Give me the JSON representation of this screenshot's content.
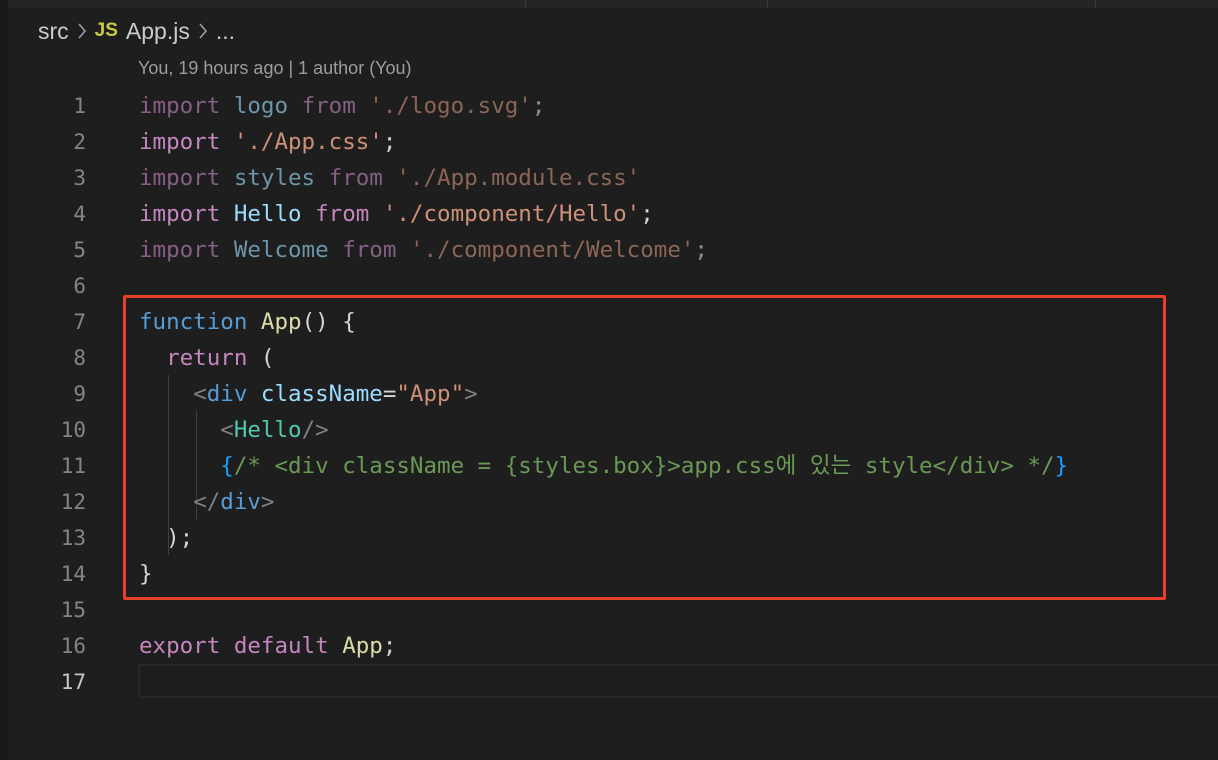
{
  "breadcrumb": {
    "folder": "src",
    "file_icon": "JS",
    "file": "App.js",
    "more": "...",
    "separator_icon": "chevron-right-icon"
  },
  "codelens": "You, 19 hours ago | 1 author (You)",
  "lines": [
    {
      "n": "1",
      "dim": true,
      "tokens": [
        {
          "t": "import",
          "c": "kw"
        },
        {
          "t": " "
        },
        {
          "t": "logo",
          "c": "id"
        },
        {
          "t": " "
        },
        {
          "t": "from",
          "c": "kw"
        },
        {
          "t": " "
        },
        {
          "t": "'./logo.svg'",
          "c": "str"
        },
        {
          "t": ";",
          "c": "pun"
        }
      ]
    },
    {
      "n": "2",
      "tokens": [
        {
          "t": "import",
          "c": "kw"
        },
        {
          "t": " "
        },
        {
          "t": "'./App.css'",
          "c": "str"
        },
        {
          "t": ";",
          "c": "pun"
        }
      ]
    },
    {
      "n": "3",
      "dim": true,
      "tokens": [
        {
          "t": "import",
          "c": "kw"
        },
        {
          "t": " "
        },
        {
          "t": "styles",
          "c": "id"
        },
        {
          "t": " "
        },
        {
          "t": "from",
          "c": "kw"
        },
        {
          "t": " "
        },
        {
          "t": "'./App.module.css'",
          "c": "str"
        }
      ]
    },
    {
      "n": "4",
      "tokens": [
        {
          "t": "import",
          "c": "kw"
        },
        {
          "t": " "
        },
        {
          "t": "Hello",
          "c": "id"
        },
        {
          "t": " "
        },
        {
          "t": "from",
          "c": "kw"
        },
        {
          "t": " "
        },
        {
          "t": "'./component/Hello'",
          "c": "str"
        },
        {
          "t": ";",
          "c": "pun"
        }
      ]
    },
    {
      "n": "5",
      "dim": true,
      "tokens": [
        {
          "t": "import",
          "c": "kw"
        },
        {
          "t": " "
        },
        {
          "t": "Welcome",
          "c": "id"
        },
        {
          "t": " "
        },
        {
          "t": "from",
          "c": "kw"
        },
        {
          "t": " "
        },
        {
          "t": "'./component/Welcome'",
          "c": "str"
        },
        {
          "t": ";",
          "c": "pun"
        }
      ]
    },
    {
      "n": "6",
      "tokens": []
    },
    {
      "n": "7",
      "tokens": [
        {
          "t": "function",
          "c": "st"
        },
        {
          "t": " "
        },
        {
          "t": "App",
          "c": "fn"
        },
        {
          "t": "() {",
          "c": "pun"
        }
      ]
    },
    {
      "n": "8",
      "tokens": [
        {
          "t": "  "
        },
        {
          "t": "return",
          "c": "kw"
        },
        {
          "t": " (",
          "c": "pun"
        }
      ]
    },
    {
      "n": "9",
      "tokens": [
        {
          "t": "    "
        },
        {
          "t": "<",
          "c": "br"
        },
        {
          "t": "div",
          "c": "tag"
        },
        {
          "t": " "
        },
        {
          "t": "className",
          "c": "attr"
        },
        {
          "t": "=",
          "c": "pun"
        },
        {
          "t": "\"App\"",
          "c": "str"
        },
        {
          "t": ">",
          "c": "br"
        }
      ]
    },
    {
      "n": "10",
      "tokens": [
        {
          "t": "      "
        },
        {
          "t": "<",
          "c": "br"
        },
        {
          "t": "Hello",
          "c": "comp"
        },
        {
          "t": "/>",
          "c": "br"
        }
      ]
    },
    {
      "n": "11",
      "tokens": [
        {
          "t": "      "
        },
        {
          "t": "{",
          "c": "jsxb"
        },
        {
          "t": "/* <div className = {styles.box}>app.css에 있는 style</div> */",
          "c": "cmt"
        },
        {
          "t": "}",
          "c": "jsxb"
        }
      ]
    },
    {
      "n": "12",
      "tokens": [
        {
          "t": "    "
        },
        {
          "t": "</",
          "c": "br"
        },
        {
          "t": "div",
          "c": "tag"
        },
        {
          "t": ">",
          "c": "br"
        }
      ]
    },
    {
      "n": "13",
      "tokens": [
        {
          "t": "  "
        },
        {
          "t": ");",
          "c": "pun"
        }
      ]
    },
    {
      "n": "14",
      "tokens": [
        {
          "t": "}",
          "c": "pun"
        }
      ]
    },
    {
      "n": "15",
      "tokens": []
    },
    {
      "n": "16",
      "tokens": [
        {
          "t": "export",
          "c": "kw"
        },
        {
          "t": " "
        },
        {
          "t": "default",
          "c": "kw"
        },
        {
          "t": " "
        },
        {
          "t": "App",
          "c": "fn"
        },
        {
          "t": ";",
          "c": "pun"
        }
      ]
    },
    {
      "n": "17",
      "active": true,
      "tokens": []
    }
  ],
  "colors": {
    "background": "#1e1e1e",
    "highlight_box": "#e8412b",
    "keyword": "#c586c0",
    "string": "#ce9178",
    "comment": "#6a9955"
  }
}
